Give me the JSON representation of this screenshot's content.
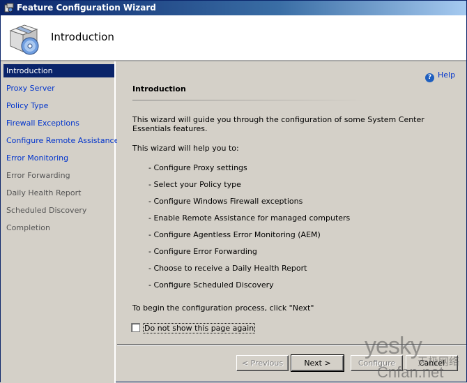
{
  "window": {
    "title": "Feature Configuration Wizard"
  },
  "header": {
    "page_title": "Introduction"
  },
  "sidebar": {
    "items": [
      {
        "label": "Introduction",
        "state": "active"
      },
      {
        "label": "Proxy Server",
        "state": "link"
      },
      {
        "label": "Policy Type",
        "state": "link"
      },
      {
        "label": "Firewall Exceptions",
        "state": "link"
      },
      {
        "label": "Configure Remote Assistance",
        "state": "link"
      },
      {
        "label": "Error Monitoring",
        "state": "link"
      },
      {
        "label": "Error Forwarding",
        "state": "disabled"
      },
      {
        "label": "Daily Health Report",
        "state": "disabled"
      },
      {
        "label": "Scheduled Discovery",
        "state": "disabled"
      },
      {
        "label": "Completion",
        "state": "disabled"
      }
    ]
  },
  "content": {
    "help_label": "Help",
    "section_title": "Introduction",
    "intro_text": "This wizard will guide you through the configuration of some System Center Essentials features.",
    "list_intro": "This wizard will help you to:",
    "bullets": [
      "- Configure Proxy settings",
      "- Select your Policy type",
      "- Configure Windows Firewall exceptions",
      "- Enable Remote Assistance for managed computers",
      "- Configure Agentless Error Monitoring (AEM)",
      "- Configure Error Forwarding",
      "- Choose to receive a Daily Health Report",
      "- Configure Scheduled Discovery"
    ],
    "begin_text": "To begin the configuration process, click \"Next\""
  },
  "options": {
    "dont_show_label": "Do not show this page again",
    "dont_show_checked": false
  },
  "buttons": {
    "previous": "< Previous",
    "next": "Next >",
    "configure": "Configure",
    "cancel": "Cancel"
  },
  "colors": {
    "title_bar": "#0a246a",
    "selection": "#0a246a",
    "link": "#0033cc"
  },
  "watermark": {
    "brand": "yesky",
    "cn": "天极网络",
    "site": "Cnfan.net"
  }
}
